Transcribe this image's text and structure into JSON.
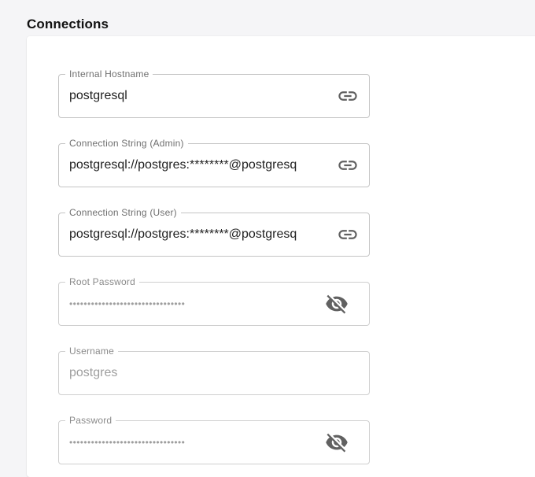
{
  "section": {
    "title": "Connections"
  },
  "fields": [
    {
      "label": "Internal Hostname",
      "value": "postgresql",
      "icon": "link-icon"
    },
    {
      "label": "Connection String (Admin)",
      "value": "postgresql://postgres:********@postgresq",
      "icon": "link-icon"
    },
    {
      "label": "Connection String (User)",
      "value": "postgresql://postgres:********@postgresq",
      "icon": "link-icon"
    },
    {
      "label": "Root Password",
      "value": "••••••••••••••••••••••••••••••••",
      "icon": "visibility-off-icon"
    },
    {
      "label": "Username",
      "value": "postgres"
    },
    {
      "label": "Password",
      "value": "••••••••••••••••••••••••••••••••",
      "icon": "visibility-off-icon"
    }
  ],
  "colors": {
    "background": "#f5f5f7",
    "card": "#ffffff",
    "border": "#c4c4c4",
    "icon": "#616161"
  }
}
